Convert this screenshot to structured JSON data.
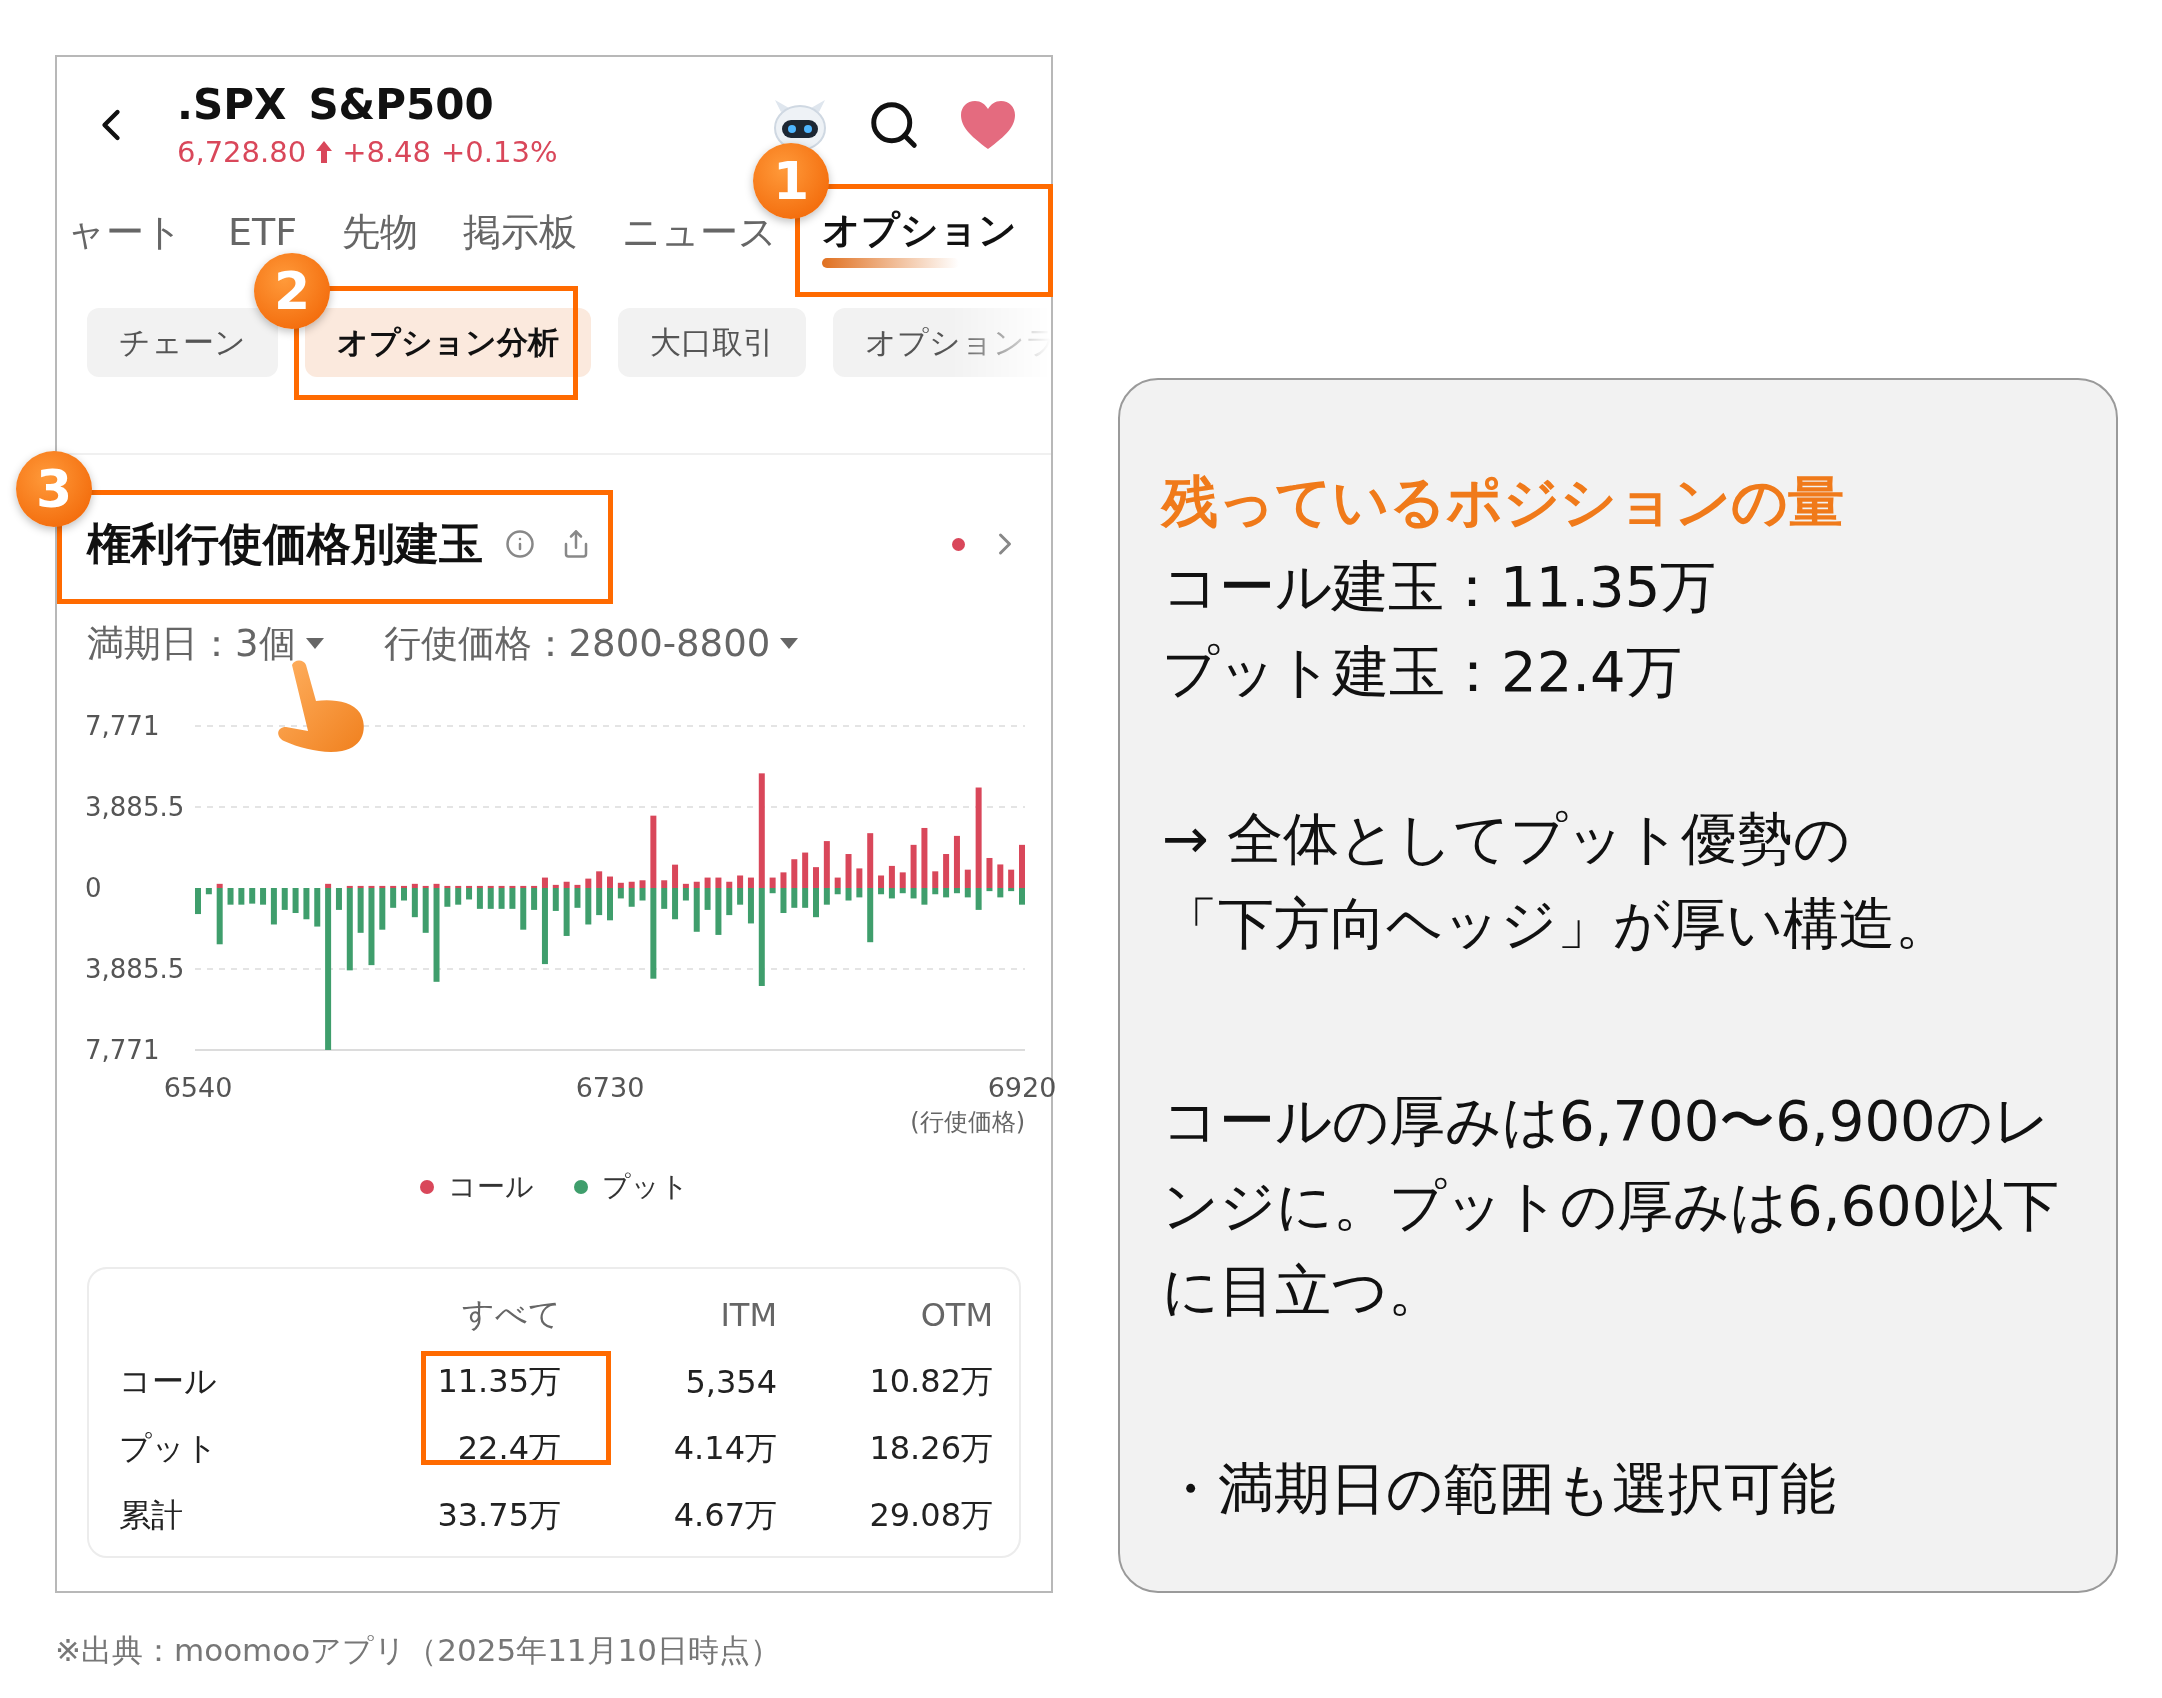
{
  "header": {
    "symbol": ".SPX",
    "name": "S&P500",
    "price": "6,728.80",
    "change": "+8.48",
    "change_pct": "+0.13%"
  },
  "tabs": [
    {
      "label": "ャート",
      "selected": false
    },
    {
      "label": "ETF",
      "selected": false
    },
    {
      "label": "先物",
      "selected": false
    },
    {
      "label": "掲示板",
      "selected": false
    },
    {
      "label": "ニュース",
      "selected": false
    },
    {
      "label": "オプション",
      "selected": true
    }
  ],
  "sub_tabs": [
    {
      "label": "チェーン",
      "selected": false
    },
    {
      "label": "オプション分析",
      "selected": true
    },
    {
      "label": "大口取引",
      "selected": false
    },
    {
      "label": "オプションラ",
      "selected": false
    }
  ],
  "section": {
    "title": "権利行使価格別建玉",
    "filters": [
      {
        "label": "満期日：3個"
      },
      {
        "label": "行使価格：2800-8800"
      }
    ],
    "chart_data": {
      "type": "bar",
      "xlabel": "(行使価格)",
      "stacked": true,
      "x": [
        6540,
        6545,
        6550,
        6555,
        6560,
        6565,
        6570,
        6575,
        6580,
        6585,
        6590,
        6595,
        6600,
        6605,
        6610,
        6615,
        6620,
        6625,
        6630,
        6635,
        6640,
        6645,
        6650,
        6655,
        6660,
        6665,
        6670,
        6675,
        6680,
        6685,
        6690,
        6695,
        6700,
        6705,
        6710,
        6715,
        6720,
        6725,
        6730,
        6735,
        6740,
        6745,
        6750,
        6755,
        6760,
        6765,
        6770,
        6775,
        6780,
        6785,
        6790,
        6795,
        6800,
        6805,
        6810,
        6815,
        6820,
        6825,
        6830,
        6835,
        6840,
        6845,
        6850,
        6855,
        6860,
        6865,
        6870,
        6875,
        6880,
        6885,
        6890,
        6895,
        6900,
        6905,
        6910,
        6915,
        6920
      ],
      "xlim": [
        6540,
        6920
      ],
      "series": [
        {
          "name": "コール",
          "color": "#d9475a",
          "values": [
            0,
            0,
            200,
            0,
            0,
            0,
            0,
            0,
            0,
            0,
            0,
            0,
            200,
            0,
            100,
            100,
            100,
            100,
            100,
            100,
            200,
            100,
            200,
            100,
            100,
            100,
            100,
            100,
            100,
            100,
            100,
            100,
            500,
            150,
            300,
            150,
            450,
            800,
            550,
            250,
            300,
            370,
            3470,
            370,
            1120,
            200,
            300,
            500,
            500,
            300,
            600,
            500,
            5500,
            500,
            750,
            1380,
            1700,
            1000,
            2250,
            500,
            1630,
            940,
            2630,
            600,
            1060,
            750,
            2070,
            2880,
            800,
            1630,
            2500,
            880,
            4820,
            1440,
            1130,
            880,
            2070
          ]
        },
        {
          "name": "プット",
          "color": "#3f9e6c",
          "values": [
            -1250,
            -300,
            -2700,
            -800,
            -800,
            -750,
            -800,
            -1750,
            -1050,
            -1200,
            -1500,
            -1850,
            -7770,
            -1050,
            -3950,
            -2150,
            -3700,
            -2000,
            -950,
            -600,
            -1400,
            -2150,
            -4500,
            -900,
            -800,
            -550,
            -1000,
            -1000,
            -1000,
            -1000,
            -2000,
            -1050,
            -3650,
            -1100,
            -2300,
            -950,
            -1750,
            -1300,
            -1550,
            -500,
            -900,
            -600,
            -4350,
            -1000,
            -1500,
            -600,
            -2100,
            -1050,
            -2250,
            -1300,
            -800,
            -1700,
            -4700,
            -250,
            -1200,
            -950,
            -950,
            -1400,
            -800,
            -300,
            -600,
            -450,
            -2600,
            -300,
            -500,
            -250,
            -500,
            -800,
            -300,
            -450,
            -250,
            -450,
            -1050,
            -150,
            -450,
            -150,
            -800
          ]
        }
      ],
      "xticks": [
        6540,
        6730,
        6920
      ],
      "yticks": [
        {
          "value": 7771,
          "label": "7,771"
        },
        {
          "value": 3885.5,
          "label": "3,885.5"
        },
        {
          "value": 0,
          "label": "0"
        },
        {
          "value": -3885.5,
          "label": "3,885.5"
        },
        {
          "value": -7771,
          "label": "7,771"
        }
      ],
      "ylim": [
        -7771,
        7771
      ]
    }
  },
  "table": {
    "columns": [
      "すべて",
      "ITM",
      "OTM"
    ],
    "rows": [
      {
        "label": "コール",
        "cells": [
          "11.35万",
          "5,354",
          "10.82万"
        ]
      },
      {
        "label": "プット",
        "cells": [
          "22.4万",
          "4.14万",
          "18.26万"
        ]
      },
      {
        "label": "累計",
        "cells": [
          "33.75万",
          "4.67万",
          "29.08万"
        ]
      }
    ]
  },
  "annotations": [
    {
      "number": "1"
    },
    {
      "number": "2"
    },
    {
      "number": "3"
    }
  ],
  "source_note": "※出典：moomooアプリ（2025年11月10日時点）",
  "notes": {
    "heading": "残っているポジションの量",
    "lines": [
      "コール建玉：11.35万",
      "プット建玉：22.4万"
    ],
    "conclusion": [
      "→ 全体としてプット優勢の",
      "「下方向ヘッジ」が厚い構造。"
    ],
    "detail": "コールの厚みは6,700〜6,900のレンジに。プットの厚みは6,600以下に目立つ。",
    "bullet": "・満期日の範囲も選択可能"
  }
}
